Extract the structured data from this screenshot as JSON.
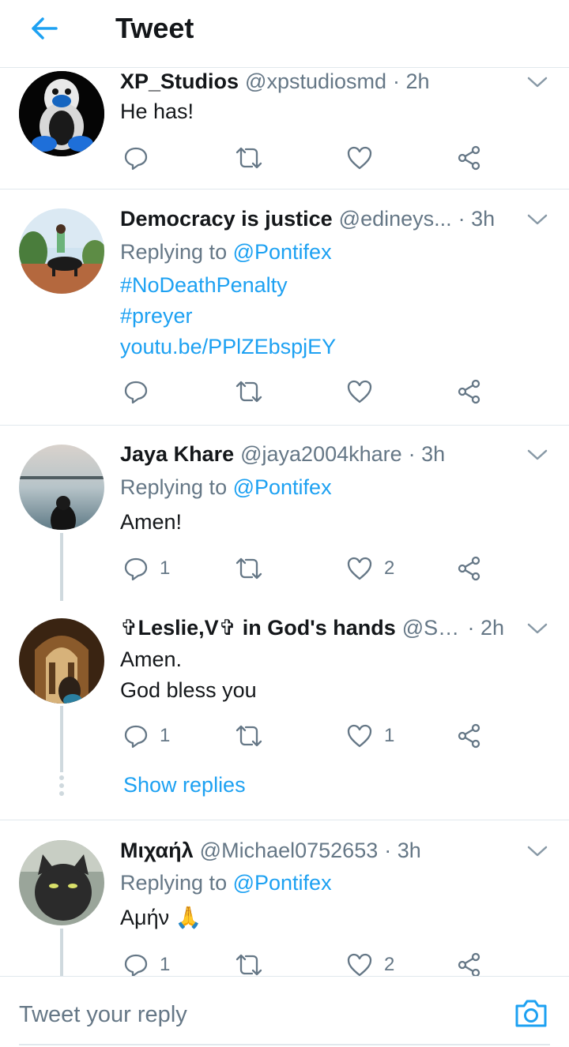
{
  "header": {
    "title": "Tweet",
    "back_icon": "arrow-left-icon"
  },
  "colors": {
    "accent": "#1da1f2",
    "secondary_text": "#657786",
    "divider": "#e1e8ed"
  },
  "tweets": [
    {
      "name": "XP_Studios",
      "handle": "@xpstudiosmd",
      "time": "· 2h",
      "text": "He has!",
      "reply_count": "",
      "like_count": ""
    },
    {
      "name": "Democracy is justice",
      "handle": "@edineys...",
      "time": "· 3h",
      "replying_prefix": "Replying to",
      "replying_to": "@Pontifex",
      "lines": [
        "#NoDeathPenalty",
        "#preyer",
        "youtu.be/PPlZEbspjEY"
      ],
      "reply_count": "",
      "like_count": ""
    },
    {
      "name": "Jaya Khare",
      "handle": "@jaya2004khare",
      "time": "· 3h",
      "replying_prefix": "Replying to",
      "replying_to": "@Pontifex",
      "text": "Amen!",
      "reply_count": "1",
      "like_count": "2"
    },
    {
      "name": "✞Leslie,V✞ in God's hands",
      "handle": "@So...",
      "time": "· 2h",
      "lines": [
        "Amen.",
        "God bless you"
      ],
      "reply_count": "1",
      "like_count": "1",
      "show_replies": "Show replies"
    },
    {
      "name": "Μιχαήλ",
      "handle": "@Michael0752653",
      "time": "· 3h",
      "replying_prefix": "Replying to",
      "replying_to": "@Pontifex",
      "text": "Αμήν 🙏",
      "reply_count": "1",
      "like_count": "2"
    }
  ],
  "reply_bar": {
    "placeholder": "Tweet your reply",
    "camera_icon": "camera-icon"
  }
}
